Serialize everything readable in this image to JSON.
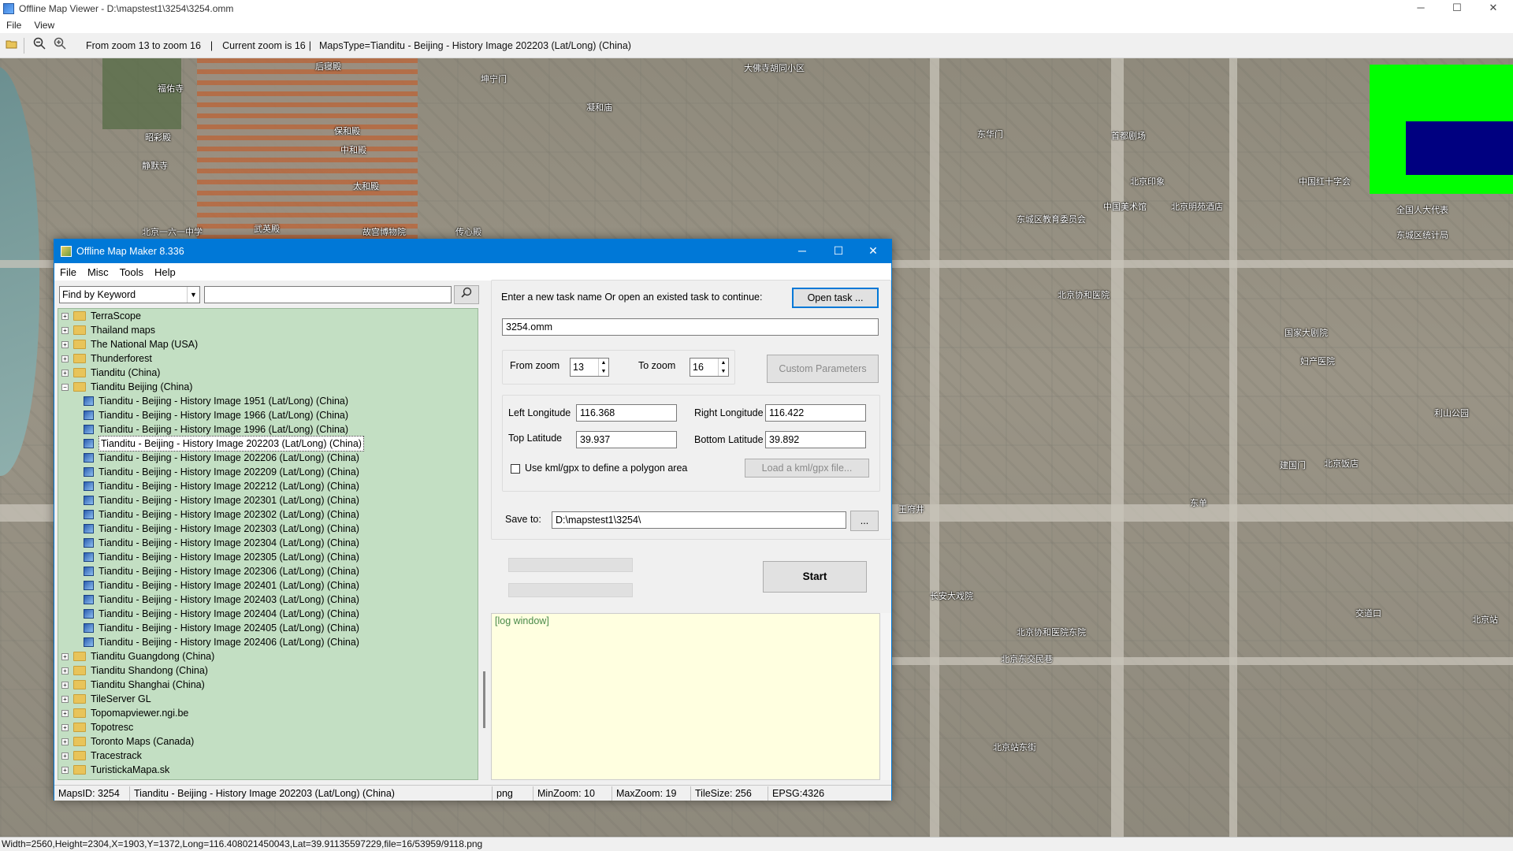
{
  "viewer": {
    "title": "Offline Map Viewer - D:\\mapstest1\\3254\\3254.omm",
    "menu": [
      "File",
      "View"
    ],
    "controls": {
      "minimize": "─",
      "maximize": "☐",
      "close": "✕"
    },
    "toolbar_info": {
      "zoom_range": "From zoom 13 to zoom 16",
      "current_zoom": "Current zoom is 16",
      "maps_type": "MapsType=Tianditu - Beijing - History Image 202203 (Lat/Long) (China)"
    },
    "status_text": "Width=2560,Height=2304,X=1903,Y=1372,Long=116.408021450043,Lat=39.91135597229,file=16/53959/9118.png"
  },
  "map_labels": [
    "后寝殿",
    "福佑寺",
    "坤宁门",
    "凝和庙",
    "大佛寺胡同小区",
    "北京一六一中学",
    "故宫博物院",
    "保和殿",
    "中和殿",
    "太和殿",
    "昭彩殿",
    "静默寺",
    "武英殿",
    "传心殿",
    "东城区教育委员会",
    "北京协和医院",
    "王府井",
    "东单",
    "北京站",
    "东城区统计局",
    "中国美术馆",
    "交道口",
    "建国门",
    "北京饭店",
    "北京明苑酒店",
    "妇产医院",
    "中国红十字会",
    "全国人大代表",
    "北京印象",
    "北京东交民巷",
    "北京协和医院东院",
    "东华门",
    "首都剧场",
    "国家大剧院",
    "利山公园",
    "北京站东街",
    "长安大戏院"
  ],
  "maker": {
    "title": "Offline Map Maker 8.336",
    "menu": [
      "File",
      "Misc",
      "Tools",
      "Help"
    ],
    "controls": {
      "minimize": "─",
      "maximize": "☐",
      "close": "✕"
    },
    "search_mode": "Find by Keyword",
    "search_value": "",
    "tree": [
      {
        "label": "TerraScope",
        "level": 0,
        "kind": "folder",
        "expander": "+"
      },
      {
        "label": "Thailand maps",
        "level": 0,
        "kind": "folder",
        "expander": "+"
      },
      {
        "label": "The National Map (USA)",
        "level": 0,
        "kind": "folder",
        "expander": "+"
      },
      {
        "label": "Thunderforest",
        "level": 0,
        "kind": "folder",
        "expander": "+"
      },
      {
        "label": "Tianditu (China)",
        "level": 0,
        "kind": "folder",
        "expander": "+"
      },
      {
        "label": "Tianditu Beijing (China)",
        "level": 0,
        "kind": "folder",
        "expander": "−"
      },
      {
        "label": "Tianditu - Beijing - History Image 1951 (Lat/Long) (China)",
        "level": 1,
        "kind": "map"
      },
      {
        "label": "Tianditu - Beijing - History Image 1966 (Lat/Long) (China)",
        "level": 1,
        "kind": "map"
      },
      {
        "label": "Tianditu - Beijing - History Image 1996 (Lat/Long) (China)",
        "level": 1,
        "kind": "map"
      },
      {
        "label": "Tianditu - Beijing - History Image 202203 (Lat/Long) (China)",
        "level": 1,
        "kind": "map",
        "selected": true
      },
      {
        "label": "Tianditu - Beijing - History Image 202206 (Lat/Long) (China)",
        "level": 1,
        "kind": "map"
      },
      {
        "label": "Tianditu - Beijing - History Image 202209 (Lat/Long) (China)",
        "level": 1,
        "kind": "map"
      },
      {
        "label": "Tianditu - Beijing - History Image 202212 (Lat/Long) (China)",
        "level": 1,
        "kind": "map"
      },
      {
        "label": "Tianditu - Beijing - History Image 202301 (Lat/Long) (China)",
        "level": 1,
        "kind": "map"
      },
      {
        "label": "Tianditu - Beijing - History Image 202302 (Lat/Long) (China)",
        "level": 1,
        "kind": "map"
      },
      {
        "label": "Tianditu - Beijing - History Image 202303 (Lat/Long) (China)",
        "level": 1,
        "kind": "map"
      },
      {
        "label": "Tianditu - Beijing - History Image 202304 (Lat/Long) (China)",
        "level": 1,
        "kind": "map"
      },
      {
        "label": "Tianditu - Beijing - History Image 202305 (Lat/Long) (China)",
        "level": 1,
        "kind": "map"
      },
      {
        "label": "Tianditu - Beijing - History Image 202306 (Lat/Long) (China)",
        "level": 1,
        "kind": "map"
      },
      {
        "label": "Tianditu - Beijing - History Image 202401 (Lat/Long) (China)",
        "level": 1,
        "kind": "map"
      },
      {
        "label": "Tianditu - Beijing - History Image 202403 (Lat/Long) (China)",
        "level": 1,
        "kind": "map"
      },
      {
        "label": "Tianditu - Beijing - History Image 202404 (Lat/Long) (China)",
        "level": 1,
        "kind": "map"
      },
      {
        "label": "Tianditu - Beijing - History Image 202405 (Lat/Long) (China)",
        "level": 1,
        "kind": "map"
      },
      {
        "label": "Tianditu - Beijing - History Image 202406 (Lat/Long) (China)",
        "level": 1,
        "kind": "map"
      },
      {
        "label": "Tianditu Guangdong (China)",
        "level": 0,
        "kind": "folder",
        "expander": "+"
      },
      {
        "label": "Tianditu Shandong (China)",
        "level": 0,
        "kind": "folder",
        "expander": "+"
      },
      {
        "label": "Tianditu Shanghai (China)",
        "level": 0,
        "kind": "folder",
        "expander": "+"
      },
      {
        "label": "TileServer GL",
        "level": 0,
        "kind": "folder",
        "expander": "+"
      },
      {
        "label": "Topomapviewer.ngi.be",
        "level": 0,
        "kind": "folder",
        "expander": "+"
      },
      {
        "label": "Topotresc",
        "level": 0,
        "kind": "folder",
        "expander": "+"
      },
      {
        "label": "Toronto Maps (Canada)",
        "level": 0,
        "kind": "folder",
        "expander": "+"
      },
      {
        "label": "Tracestrack",
        "level": 0,
        "kind": "folder",
        "expander": "+"
      },
      {
        "label": "TuristickaMapa.sk",
        "level": 0,
        "kind": "folder",
        "expander": "+"
      }
    ],
    "task_prompt": "Enter a new task name Or open an existed task to continue:",
    "open_task_label": "Open task ...",
    "task_name": "3254.omm",
    "from_zoom_label": "From zoom",
    "from_zoom": "13",
    "to_zoom_label": "To zoom",
    "to_zoom": "16",
    "custom_params_label": "Custom Parameters",
    "left_lon_label": "Left Longitude",
    "left_lon": "116.368",
    "right_lon_label": "Right Longitude",
    "right_lon": "116.422",
    "top_lat_label": "Top Latitude",
    "top_lat": "39.937",
    "bottom_lat_label": "Bottom Latitude",
    "bottom_lat": "39.892",
    "kml_label": "Use kml/gpx to define a polygon area",
    "kml_checked": false,
    "load_kml_label": "Load a kml/gpx file...",
    "save_to_label": "Save to:",
    "save_to": "D:\\mapstest1\\3254\\",
    "browse_label": "...",
    "start_label": "Start",
    "log_text": "[log window]",
    "status": {
      "maps_id": "MapsID: 3254",
      "map_name": "Tianditu - Beijing - History Image 202203 (Lat/Long) (China)",
      "format": "png",
      "min_zoom": "MinZoom: 10",
      "max_zoom": "MaxZoom: 19",
      "tile_size": "TileSize: 256",
      "epsg": "EPSG:4326"
    }
  },
  "colors": {
    "overlay_green": "#00ff00",
    "overlay_navy": "#000080",
    "tree_bg": "#c3dfc3",
    "log_bg": "#ffffe0",
    "titlebar_blue": "#0078d7"
  }
}
